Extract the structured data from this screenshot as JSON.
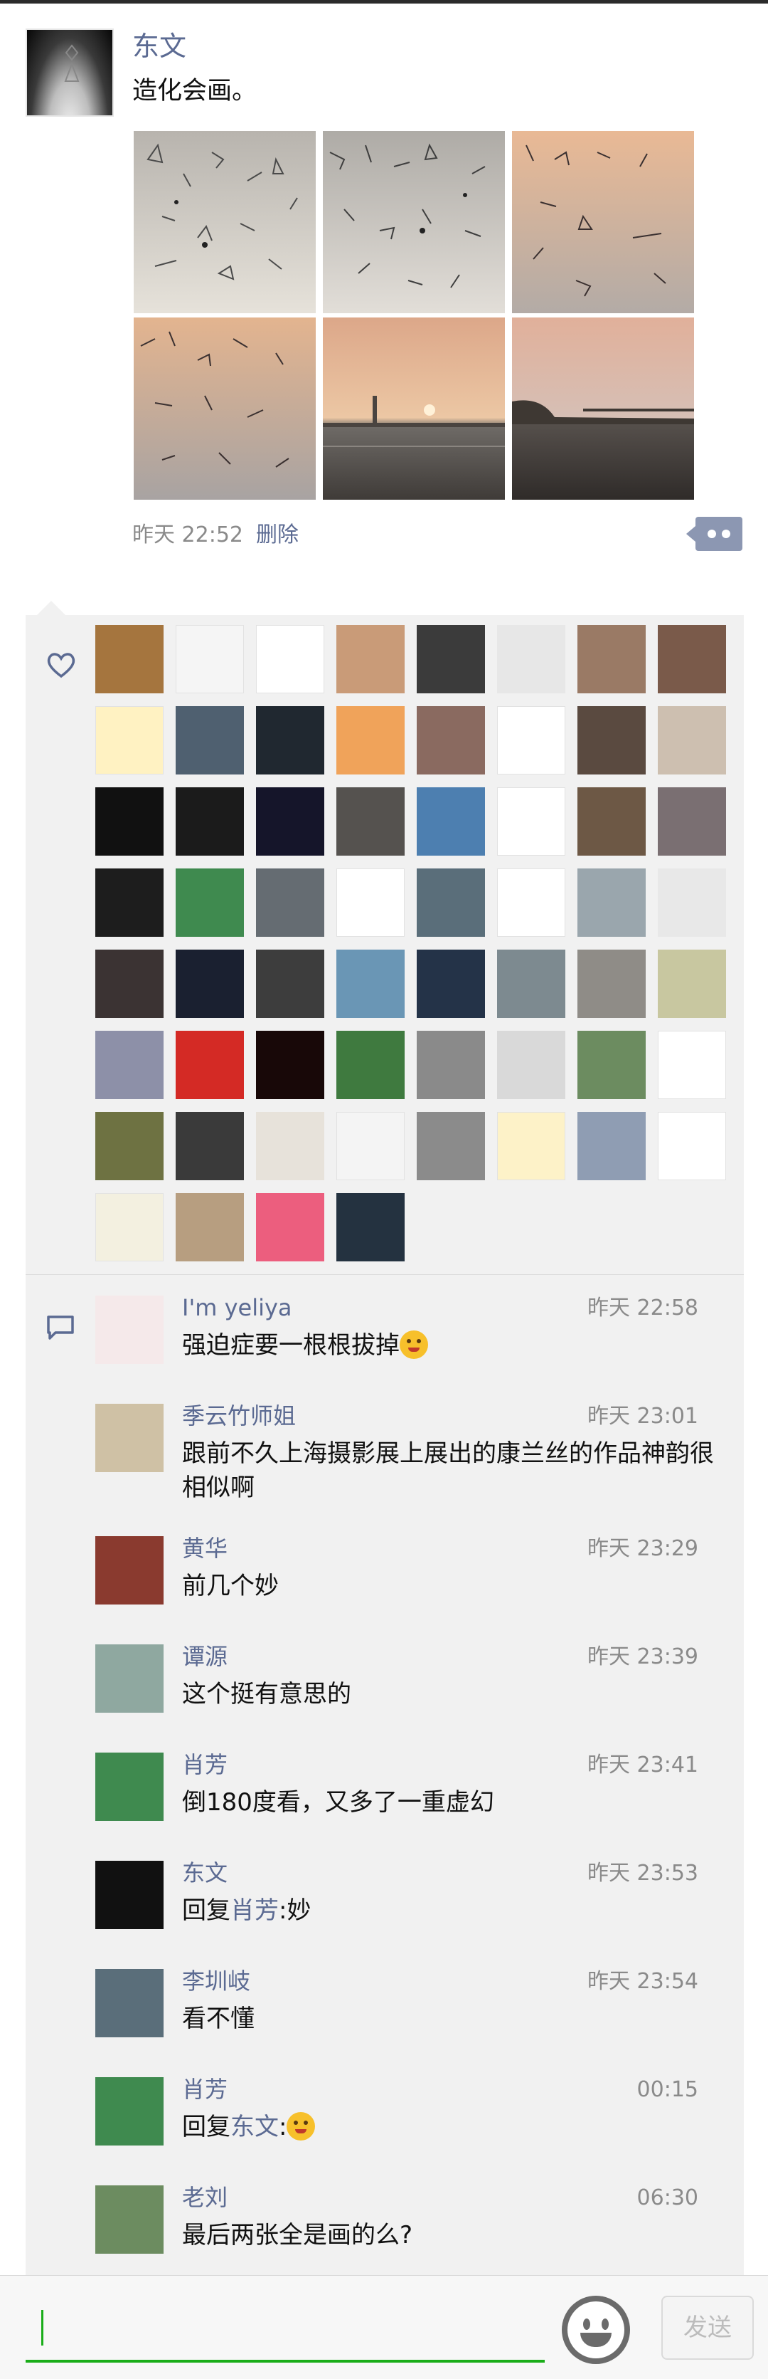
{
  "post": {
    "author": "东文",
    "text": "造化会画。",
    "photos": [
      "sunset-water-sketch-1",
      "sunset-water-sketch-2",
      "sunset-water-sketch-3",
      "sunset-water-sketch-4",
      "sunset-skyline",
      "sunset-bridge"
    ],
    "time": "昨天 22:52",
    "delete_label": "删除"
  },
  "likes": {
    "icon": "heart-icon",
    "avatars": [
      "#a5753e",
      "#f5f5f5",
      "#ffffff",
      "#c99b78",
      "#3b3b3b",
      "#e7e7e7",
      "#9a7a65",
      "#7a5a4a",
      "#fff2c2",
      "#4f6070",
      "#202830",
      "#f0a35a",
      "#8a6a60",
      "#ffffff",
      "#5a4a40",
      "#cdbfb0",
      "#111111",
      "#1b1b1b",
      "#15152a",
      "#55524f",
      "#4d7fb0",
      "#ffffff",
      "#6d5845",
      "#7a6f72",
      "#1d1d1d",
      "#3f8a4f",
      "#656c72",
      "#ffffff",
      "#5a6e7a",
      "#ffffff",
      "#9aa6ad",
      "#e8e8e8",
      "#3b3333",
      "#1a2030",
      "#3d3d3d",
      "#6a96b5",
      "#243348",
      "#7d8a90",
      "#8f8c87",
      "#c8c7a0",
      "#8d90a8",
      "#d42a25",
      "#180808",
      "#3f7a3f",
      "#8a8a8a",
      "#d9d9d9",
      "#6c8c60",
      "#ffffff",
      "#6e7242",
      "#3a3a3a",
      "#e7e2da",
      "#f4f4f4",
      "#8b8b8b",
      "#fdf2c8",
      "#8f9db3",
      "#ffffff",
      "#f3f0e0",
      "#b79e80",
      "#ec5e7e",
      "#243240"
    ]
  },
  "comments": [
    {
      "name": "I'm yeliya",
      "time": "昨天 22:58",
      "text": "强迫症要一根根拔掉",
      "ref": "",
      "tail": "",
      "emoji": "wink",
      "avatar": "#f5e9ea"
    },
    {
      "name": "季云竹师姐",
      "time": "昨天 23:01",
      "text": "跟前不久上海摄影展上展出的康兰丝的作品神韵很相似啊",
      "ref": "",
      "tail": "",
      "emoji": "",
      "avatar": "#cfc1a5"
    },
    {
      "name": "黄华",
      "time": "昨天 23:29",
      "text": "前几个妙",
      "ref": "",
      "tail": "",
      "emoji": "",
      "avatar": "#8a3a2f"
    },
    {
      "name": "谭源",
      "time": "昨天 23:39",
      "text": "这个挺有意思的",
      "ref": "",
      "tail": "",
      "emoji": "",
      "avatar": "#8fa8a0"
    },
    {
      "name": "肖芳",
      "time": "昨天 23:41",
      "text": "倒180度看，又多了一重虚幻",
      "ref": "",
      "tail": "",
      "emoji": "",
      "avatar": "#3f8a4f"
    },
    {
      "name": "东文",
      "time": "昨天 23:53",
      "text": "回复",
      "ref": "肖芳",
      "tail": ":妙",
      "emoji": "",
      "avatar": "#111111"
    },
    {
      "name": "李圳岐",
      "time": "昨天 23:54",
      "text": "看不懂",
      "ref": "",
      "tail": "",
      "emoji": "",
      "avatar": "#5a6e7a"
    },
    {
      "name": "肖芳",
      "time": "00:15",
      "text": "回复",
      "ref": "东文",
      "tail": ":",
      "emoji": "tongue",
      "avatar": "#3f8a4f"
    },
    {
      "name": "老刘",
      "time": "06:30",
      "text": "最后两张全是画的么?",
      "ref": "",
      "tail": "",
      "emoji": "",
      "avatar": "#6c8c60"
    }
  ],
  "comment_icon": "comment-icon",
  "input": {
    "placeholder": "",
    "value": ""
  },
  "send_label": "发送",
  "colors": {
    "link": "#5b6a92",
    "accent": "#1aad19",
    "panel": "#f1f1f1"
  }
}
